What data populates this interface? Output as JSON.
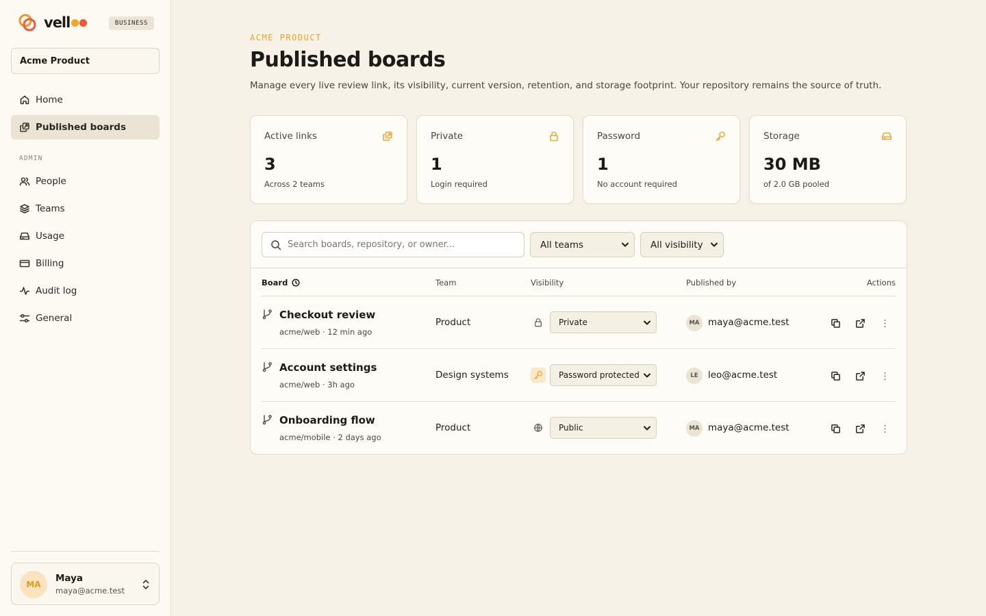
{
  "brand": {
    "name": "vell",
    "plan_badge": "BUSINESS",
    "colors": {
      "orange": "#f59320",
      "coral": "#f0583c",
      "accent": "#f0a324"
    }
  },
  "sidebar": {
    "workspace": "Acme Product",
    "primary_items": [
      {
        "label": "Home",
        "icon": "home-icon",
        "active": false
      },
      {
        "label": "Published boards",
        "icon": "boards-icon",
        "active": true
      }
    ],
    "admin_heading": "ADMIN",
    "admin_items": [
      {
        "label": "People",
        "icon": "people-icon"
      },
      {
        "label": "Teams",
        "icon": "layers-icon"
      },
      {
        "label": "Usage",
        "icon": "storage-icon"
      },
      {
        "label": "Billing",
        "icon": "credit-card-icon"
      },
      {
        "label": "Audit log",
        "icon": "activity-icon"
      },
      {
        "label": "General",
        "icon": "sliders-icon"
      }
    ],
    "user": {
      "initials": "MA",
      "name": "Maya",
      "email": "maya@acme.test"
    }
  },
  "header": {
    "eyebrow": "ACME PRODUCT",
    "title": "Published boards",
    "description": "Manage every live review link, its visibility, current version, retention, and storage footprint. Your repository remains the source of truth."
  },
  "stats": [
    {
      "label": "Active links",
      "value": "3",
      "sub": "Across 2 teams",
      "icon": "link-icon"
    },
    {
      "label": "Private",
      "value": "1",
      "sub": "Login required",
      "icon": "lock-icon"
    },
    {
      "label": "Password",
      "value": "1",
      "sub": "No account required",
      "icon": "key-icon"
    },
    {
      "label": "Storage",
      "value": "30 MB",
      "sub": "of 2.0 GB pooled",
      "icon": "storage-icon"
    }
  ],
  "filters": {
    "search_placeholder": "Search boards, repository, or owner...",
    "team": "All teams",
    "visibility": "All visibility"
  },
  "table": {
    "columns": {
      "board": "Board",
      "team": "Team",
      "visibility": "Visibility",
      "published_by": "Published by",
      "actions": "Actions"
    },
    "rows": [
      {
        "name": "Checkout review",
        "meta": "acme/web · 12 min ago",
        "team": "Product",
        "visibility": "Private",
        "vis_icon": "lock-icon",
        "owner_initials": "MA",
        "owner": "maya@acme.test"
      },
      {
        "name": "Account settings",
        "meta": "acme/web · 3h ago",
        "team": "Design systems",
        "visibility": "Password protected",
        "vis_icon": "key-icon",
        "owner_initials": "LE",
        "owner": "leo@acme.test"
      },
      {
        "name": "Onboarding flow",
        "meta": "acme/mobile · 2 days ago",
        "team": "Product",
        "visibility": "Public",
        "vis_icon": "globe-icon",
        "owner_initials": "MA",
        "owner": "maya@acme.test"
      }
    ]
  }
}
